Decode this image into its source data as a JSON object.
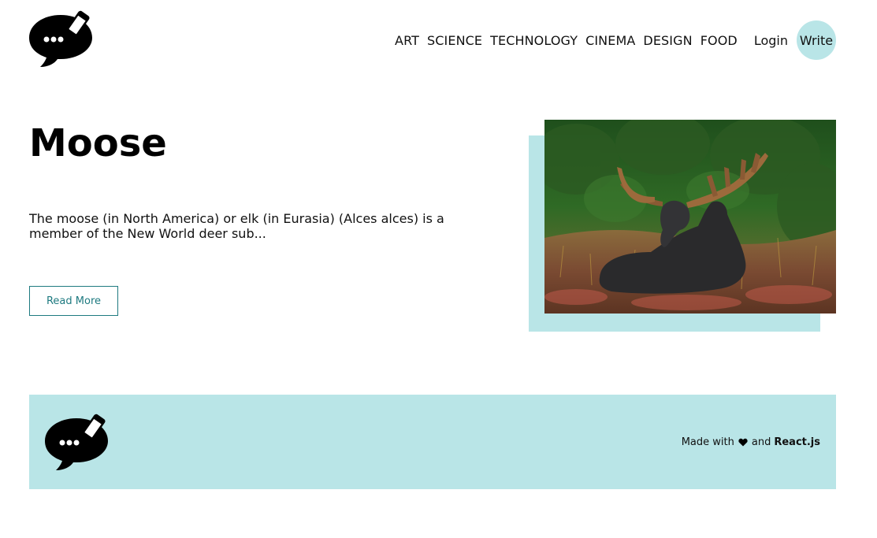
{
  "header": {
    "nav": [
      {
        "label": "ART"
      },
      {
        "label": "SCIENCE"
      },
      {
        "label": "TECHNOLOGY"
      },
      {
        "label": "CINEMA"
      },
      {
        "label": "DESIGN"
      },
      {
        "label": "FOOD"
      }
    ],
    "login_label": "Login",
    "write_label": "Write"
  },
  "post": {
    "title": "Moose",
    "description": "The moose (in North America) or elk (in Eurasia) (Alces alces) is a member of the New World deer sub...",
    "read_more_label": "Read More"
  },
  "footer": {
    "made_with": "Made with",
    "and": "and",
    "brand": "React.js"
  },
  "colors": {
    "accent": "#b9e5e7",
    "button_teal": "#1e7a80"
  },
  "icons": {
    "logo": "chat-bubble-pencil-icon",
    "heart": "heart-icon"
  }
}
